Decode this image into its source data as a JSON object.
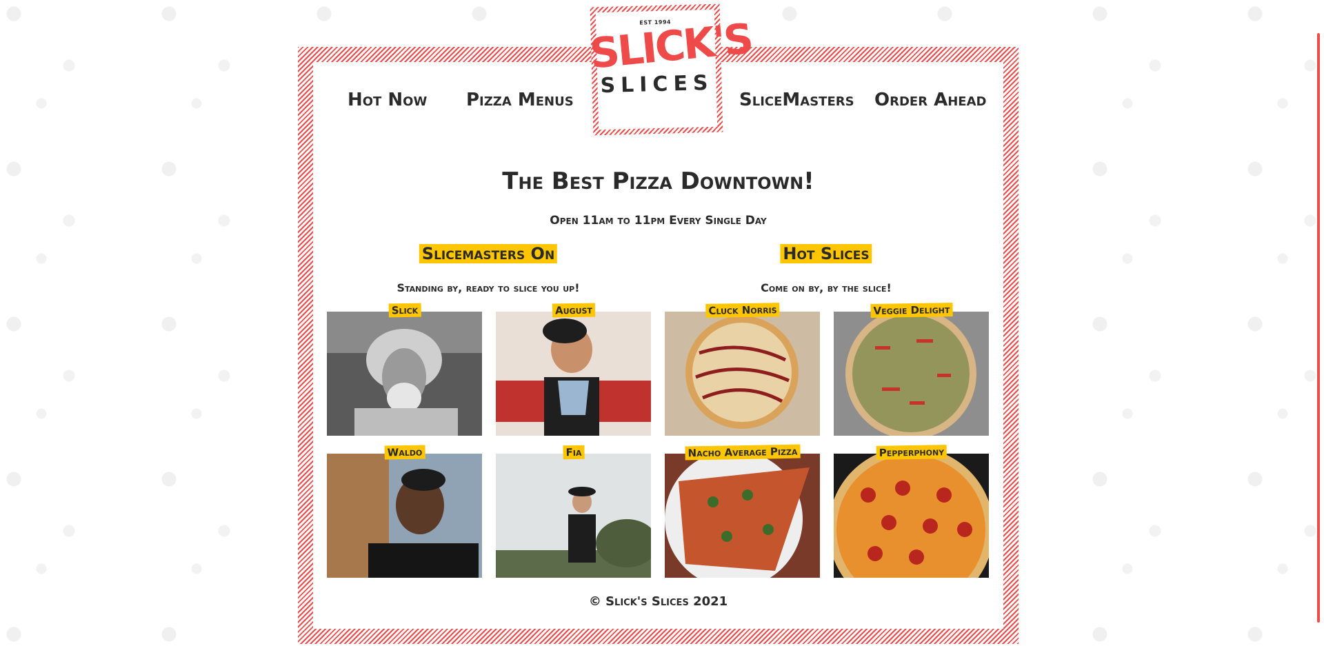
{
  "logo": {
    "est": "EST 1994",
    "name": "SLICK'S",
    "sub": "SLICES"
  },
  "nav": {
    "items": [
      "Hot Now",
      "Pizza Menus",
      "SliceMasters",
      "Order Ahead"
    ]
  },
  "main": {
    "title": "The Best Pizza Downtown!",
    "subtitle": "Open 11am to 11pm Every Single Day",
    "slicemasters": {
      "heading": "Slicemasters On",
      "subtitle": "Standing by, ready to slice you up!",
      "people": [
        "Slick",
        "August",
        "Waldo",
        "Fia"
      ]
    },
    "hotslices": {
      "heading": "Hot Slices",
      "subtitle": "Come on by, by the slice!",
      "pizzas": [
        "Cluck Norris",
        "Veggie Delight",
        "Nacho Average Pizza",
        "Pepperphony"
      ]
    }
  },
  "footer": {
    "copyright": "© Slick's Slices 2021"
  },
  "colors": {
    "brand_red": "#ef4a4a",
    "highlight_yellow": "#ffc600",
    "text": "#2a2a2a"
  }
}
